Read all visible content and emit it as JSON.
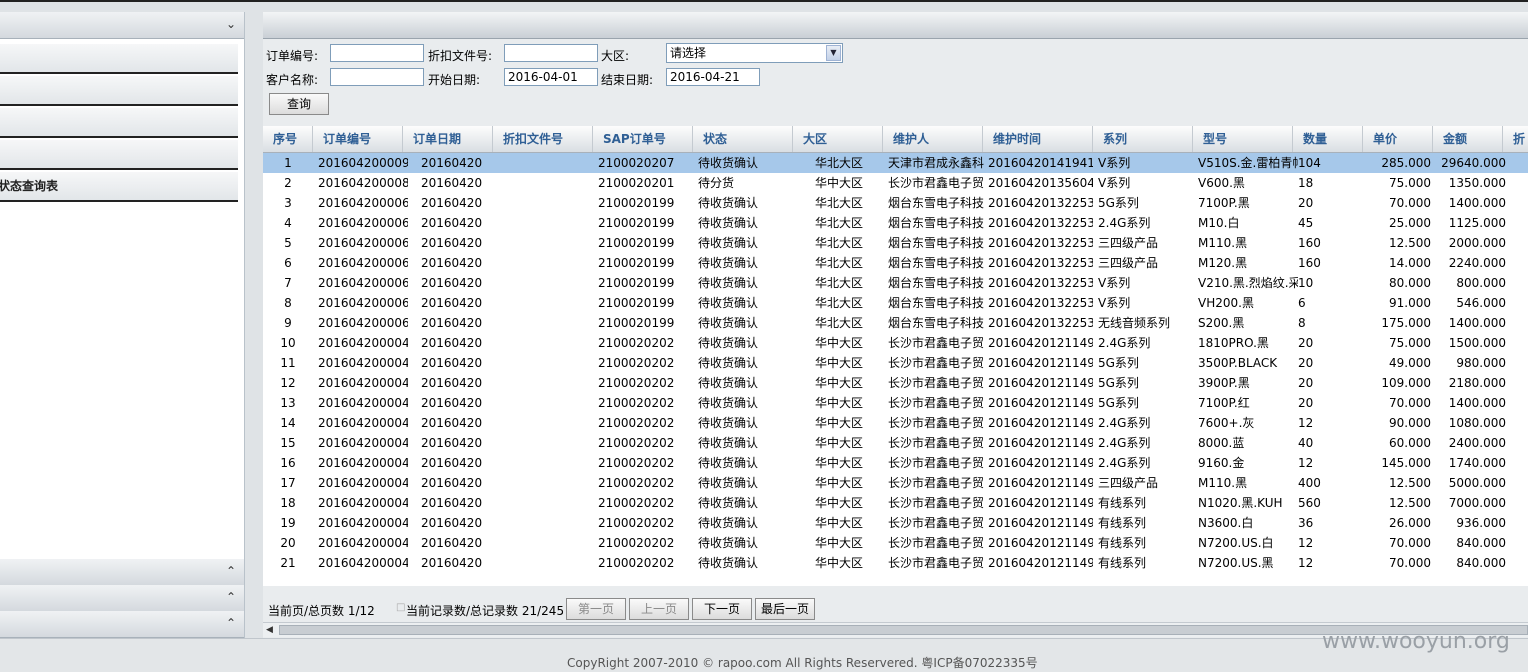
{
  "sidebar": {
    "menu_items": [
      "",
      "",
      "",
      "",
      "状态查询表"
    ]
  },
  "filters": {
    "order_no_label": "订单编号:",
    "order_no_value": "",
    "discount_doc_label": "折扣文件号:",
    "discount_doc_value": "",
    "region_label": "大区:",
    "region_value": "请选择",
    "customer_label": "客户名称:",
    "customer_value": "",
    "start_label": "开始日期:",
    "start_value": "2016-04-01",
    "end_label": "结束日期:",
    "end_value": "2016-04-21",
    "query_label": "查询"
  },
  "table": {
    "headers": [
      "序号",
      "订单编号",
      "订单日期",
      "折扣文件号",
      "SAP订单号",
      "状态",
      "大区",
      "维护人",
      "维护时间",
      "系列",
      "型号",
      "数量",
      "单价",
      "金额",
      "折"
    ],
    "rows": [
      [
        "1",
        "201604200009",
        "20160420",
        "",
        "2100020207",
        "待收货确认",
        "华北大区",
        "天津市君成永鑫科",
        "20160420141941",
        "V系列",
        "V510S.金.雷柏青帕",
        "104",
        "285.000",
        "29640.000"
      ],
      [
        "2",
        "201604200008",
        "20160420",
        "",
        "2100020201",
        "待分货",
        "华中大区",
        "长沙市君鑫电子贸",
        "20160420135604",
        "V系列",
        "V600.黑",
        "18",
        "75.000",
        "1350.000"
      ],
      [
        "3",
        "201604200006",
        "20160420",
        "",
        "2100020199",
        "待收货确认",
        "华北大区",
        "烟台东雪电子科技",
        "20160420132253",
        "5G系列",
        "7100P.黑",
        "20",
        "70.000",
        "1400.000"
      ],
      [
        "4",
        "201604200006",
        "20160420",
        "",
        "2100020199",
        "待收货确认",
        "华北大区",
        "烟台东雪电子科技",
        "20160420132253",
        "2.4G系列",
        "M10.白",
        "45",
        "25.000",
        "1125.000"
      ],
      [
        "5",
        "201604200006",
        "20160420",
        "",
        "2100020199",
        "待收货确认",
        "华北大区",
        "烟台东雪电子科技",
        "20160420132253",
        "三四级产品",
        "M110.黑",
        "160",
        "12.500",
        "2000.000"
      ],
      [
        "6",
        "201604200006",
        "20160420",
        "",
        "2100020199",
        "待收货确认",
        "华北大区",
        "烟台东雪电子科技",
        "20160420132253",
        "三四级产品",
        "M120.黑",
        "160",
        "14.000",
        "2240.000"
      ],
      [
        "7",
        "201604200006",
        "20160420",
        "",
        "2100020199",
        "待收货确认",
        "华北大区",
        "烟台东雪电子科技",
        "20160420132253",
        "V系列",
        "V210.黑.烈焰纹.采",
        "10",
        "80.000",
        "800.000"
      ],
      [
        "8",
        "201604200006",
        "20160420",
        "",
        "2100020199",
        "待收货确认",
        "华北大区",
        "烟台东雪电子科技",
        "20160420132253",
        "V系列",
        "VH200.黑",
        "6",
        "91.000",
        "546.000"
      ],
      [
        "9",
        "201604200006",
        "20160420",
        "",
        "2100020199",
        "待收货确认",
        "华北大区",
        "烟台东雪电子科技",
        "20160420132253",
        "无线音频系列",
        "S200.黑",
        "8",
        "175.000",
        "1400.000"
      ],
      [
        "10",
        "201604200004",
        "20160420",
        "",
        "2100020202",
        "待收货确认",
        "华中大区",
        "长沙市君鑫电子贸",
        "20160420121149",
        "2.4G系列",
        "1810PRO.黑",
        "20",
        "75.000",
        "1500.000"
      ],
      [
        "11",
        "201604200004",
        "20160420",
        "",
        "2100020202",
        "待收货确认",
        "华中大区",
        "长沙市君鑫电子贸",
        "20160420121149",
        "5G系列",
        "3500P.BLACK",
        "20",
        "49.000",
        "980.000"
      ],
      [
        "12",
        "201604200004",
        "20160420",
        "",
        "2100020202",
        "待收货确认",
        "华中大区",
        "长沙市君鑫电子贸",
        "20160420121149",
        "5G系列",
        "3900P.黑",
        "20",
        "109.000",
        "2180.000"
      ],
      [
        "13",
        "201604200004",
        "20160420",
        "",
        "2100020202",
        "待收货确认",
        "华中大区",
        "长沙市君鑫电子贸",
        "20160420121149",
        "5G系列",
        "7100P.红",
        "20",
        "70.000",
        "1400.000"
      ],
      [
        "14",
        "201604200004",
        "20160420",
        "",
        "2100020202",
        "待收货确认",
        "华中大区",
        "长沙市君鑫电子贸",
        "20160420121149",
        "2.4G系列",
        "7600+.灰",
        "12",
        "90.000",
        "1080.000"
      ],
      [
        "15",
        "201604200004",
        "20160420",
        "",
        "2100020202",
        "待收货确认",
        "华中大区",
        "长沙市君鑫电子贸",
        "20160420121149",
        "2.4G系列",
        "8000.蓝",
        "40",
        "60.000",
        "2400.000"
      ],
      [
        "16",
        "201604200004",
        "20160420",
        "",
        "2100020202",
        "待收货确认",
        "华中大区",
        "长沙市君鑫电子贸",
        "20160420121149",
        "2.4G系列",
        "9160.金",
        "12",
        "145.000",
        "1740.000"
      ],
      [
        "17",
        "201604200004",
        "20160420",
        "",
        "2100020202",
        "待收货确认",
        "华中大区",
        "长沙市君鑫电子贸",
        "20160420121149",
        "三四级产品",
        "M110.黑",
        "400",
        "12.500",
        "5000.000"
      ],
      [
        "18",
        "201604200004",
        "20160420",
        "",
        "2100020202",
        "待收货确认",
        "华中大区",
        "长沙市君鑫电子贸",
        "20160420121149",
        "有线系列",
        "N1020.黑.KUH",
        "560",
        "12.500",
        "7000.000"
      ],
      [
        "19",
        "201604200004",
        "20160420",
        "",
        "2100020202",
        "待收货确认",
        "华中大区",
        "长沙市君鑫电子贸",
        "20160420121149",
        "有线系列",
        "N3600.白",
        "36",
        "26.000",
        "936.000"
      ],
      [
        "20",
        "201604200004",
        "20160420",
        "",
        "2100020202",
        "待收货确认",
        "华中大区",
        "长沙市君鑫电子贸",
        "20160420121149",
        "有线系列",
        "N7200.US.白",
        "12",
        "70.000",
        "840.000"
      ],
      [
        "21",
        "201604200004",
        "20160420",
        "",
        "2100020202",
        "待收货确认",
        "华中大区",
        "长沙市君鑫电子贸",
        "20160420121149",
        "有线系列",
        "N7200.US.黑",
        "12",
        "70.000",
        "840.000"
      ]
    ]
  },
  "pager": {
    "page_info": "当前页/总页数 1/12",
    "record_info": "当前记录数/总记录数 21/245",
    "first": "第一页",
    "prev": "上一页",
    "next": "下一页",
    "last": "最后一页"
  },
  "footer": {
    "copyright": "CopyRight 2007-2010 © rapoo.com All Rights Reservered. 粤ICP备07022335号"
  },
  "watermark": "www.wooyun.org",
  "colors": {
    "selected_row": "#a6c8ea",
    "header_text": "#2f5f95"
  }
}
